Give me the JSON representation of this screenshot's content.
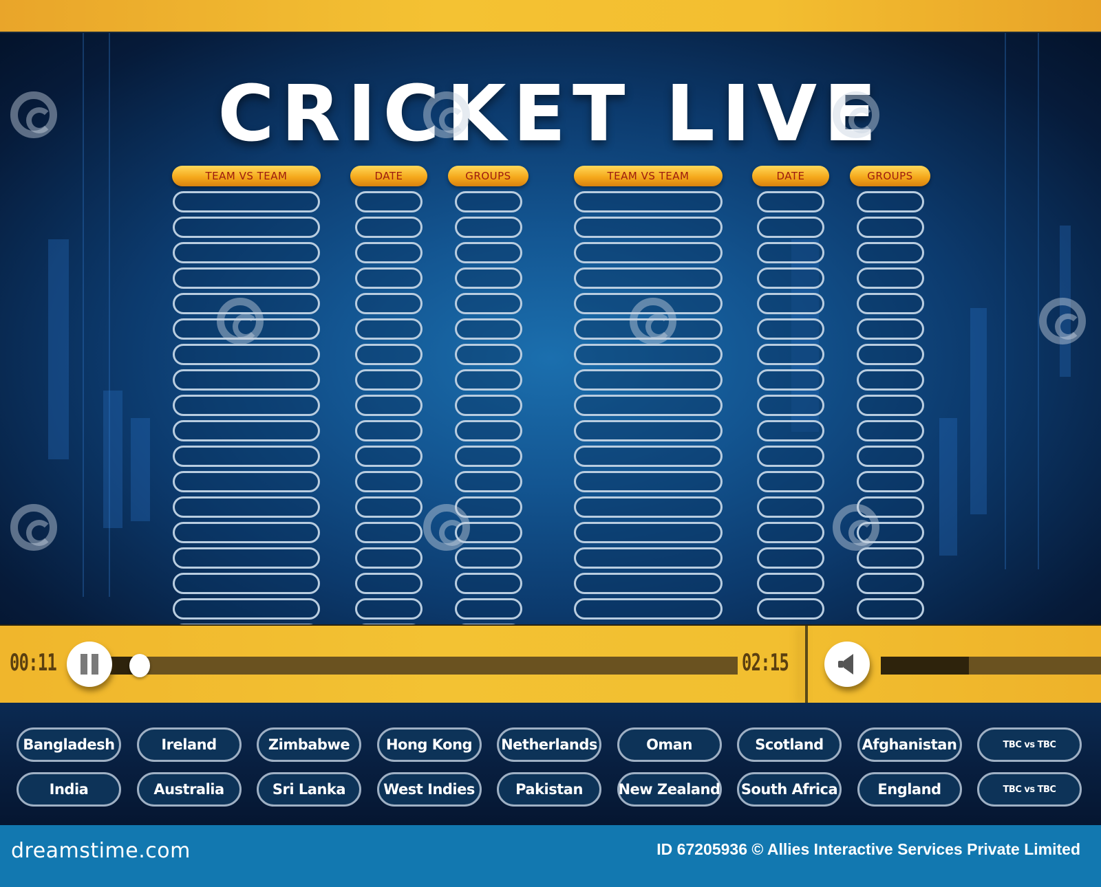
{
  "title": "CRICKET LIVE",
  "schedule": {
    "left_group": {
      "rows": 18,
      "columns": [
        {
          "key": "team_vs_team",
          "label": "TEAM VS TEAM"
        },
        {
          "key": "date",
          "label": "DATE"
        },
        {
          "key": "groups",
          "label": "GROUPS"
        }
      ]
    },
    "right_group": {
      "rows": 17,
      "columns": [
        {
          "key": "team_vs_team",
          "label": "TEAM VS TEAM"
        },
        {
          "key": "date",
          "label": "DATE"
        },
        {
          "key": "groups",
          "label": "GROUPS"
        }
      ]
    }
  },
  "player": {
    "elapsed": "00:11",
    "duration": "02:15",
    "progress_percent": 4,
    "volume_percent": 40,
    "pause_icon": "pause-icon",
    "volume_icon": "speaker-icon"
  },
  "teams": {
    "row1": [
      "Bangladesh",
      "Ireland",
      "Zimbabwe",
      "Hong Kong",
      "Netherlands",
      "Oman",
      "Scotland",
      "Afghanistan",
      "TBC vs TBC"
    ],
    "row2": [
      "India",
      "Australia",
      "Sri Lanka",
      "West Indies",
      "Pakistan",
      "New Zealand",
      "South Africa",
      "England",
      "TBC vs TBC"
    ]
  },
  "footer": {
    "brand": "dreamstime.com",
    "credit": "ID 67205936 © Allies Interactive Services Private Limited"
  },
  "colors": {
    "accent_yellow": "#f3c233",
    "header_orange": "#f5a91c",
    "header_text": "#9c1a0e",
    "cell_border": "#b9cde0",
    "footer_blue": "#1278b0"
  }
}
